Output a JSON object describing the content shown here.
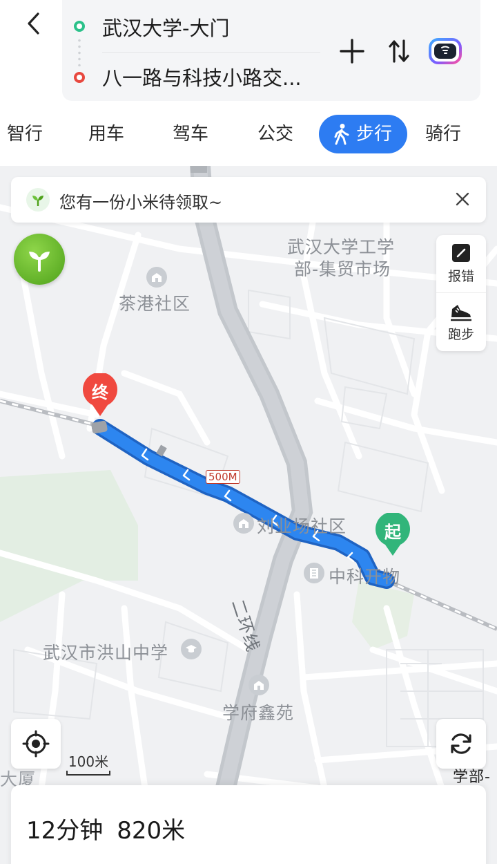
{
  "route": {
    "start": "武汉大学-大门",
    "end": "八一路与科技小路交..."
  },
  "tabs": [
    {
      "label": "智行",
      "active": false
    },
    {
      "label": "用车",
      "active": false
    },
    {
      "label": "驾车",
      "active": false
    },
    {
      "label": "公交",
      "active": false
    },
    {
      "label": "步行",
      "active": true
    },
    {
      "label": "骑行",
      "active": false
    }
  ],
  "banner": {
    "text": "您有一份小米待领取~"
  },
  "side_tools": {
    "report": "报错",
    "run": "跑步"
  },
  "map": {
    "pois": {
      "wuda_gongxue": "武汉大学工学",
      "jimao": "部-集贸市场",
      "chagang": "茶港社区",
      "liuyechang": "刘业场社区",
      "zhongke": "中科开物",
      "hongshan": "武汉市洪山中学",
      "xuefu": "学府鑫苑",
      "ring_road": "二环线",
      "dasha": "大厦",
      "right_edge": "学部-"
    },
    "start_marker": "起",
    "end_marker": "终",
    "distance_marker": "500M",
    "scale_label": "100米",
    "route_color": "#2d86f0",
    "accent_color": "#2d7cf2"
  },
  "summary": {
    "time": "12分钟",
    "distance": "820米"
  }
}
